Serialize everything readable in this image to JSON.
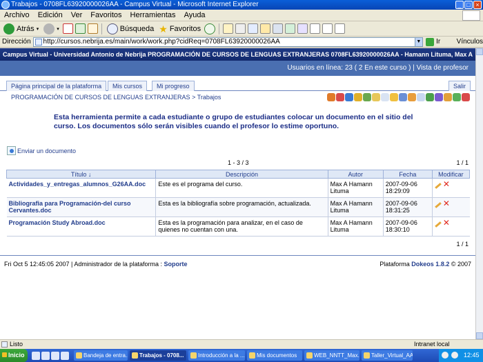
{
  "window": {
    "title": "Trabajos - 0708FL63920000026AA - Campus Virtual - Microsoft Internet Explorer"
  },
  "menu": [
    "Archivo",
    "Edición",
    "Ver",
    "Favoritos",
    "Herramientas",
    "Ayuda"
  ],
  "toolbar": {
    "back_label": "Atrás",
    "search_label": "Búsqueda",
    "favorites_label": "Favoritos"
  },
  "address": {
    "label": "Dirección",
    "url": "http://cursos.nebrija.es/main/work/work.php?cidReq=0708FL63920000026AA",
    "go_label": "Ir",
    "links_label": "Vínculos"
  },
  "site": {
    "header_left": "Campus Virtual - Universidad Antonio de Nebrija",
    "header_right": "PROGRAMACIÓN DE CURSOS DE LENGUAS EXTRANJERAS 0708FL63920000026AA - Hamann Lituma, Max A",
    "online_prefix": "Usuarios en línea:",
    "online_count": "23",
    "online_course": "( 2 En este curso )",
    "teacher_view": "| Vista de profesor"
  },
  "tabs": [
    "Página principal de la plataforma",
    "Mis cursos",
    "Mi progreso"
  ],
  "logout_label": "Salir",
  "breadcrumb": {
    "course": "PROGRAMACIÓN DE CURSOS DE LENGUAS EXTRANJERAS",
    "separator": ">",
    "current": "Trabajos"
  },
  "intro_text": "Esta herramienta permite a cada estudiante o grupo de estudiantes colocar un documento en el sitio del curso. Los documentos sólo serán visibles cuando el profesor lo estime oportuno.",
  "send_label": "Enviar un documento",
  "pager": {
    "range": "1 - 3 / 3",
    "page_top": "1 / 1",
    "page_bottom": "1 / 1"
  },
  "table": {
    "headers": [
      "Título",
      "Descripción",
      "Autor",
      "Fecha",
      "Modificar"
    ],
    "sort_indicator": "↓",
    "rows": [
      {
        "title": "Actividades_y_entregas_alumnos_G26AA.doc",
        "description": "Este es el programa del curso.",
        "author": "Max A Hamann Lituma",
        "date": "2007-09-06 18:29:09"
      },
      {
        "title": "Bibliografia para Programación-del curso Cervantes.doc",
        "description": "Esta es la bibliografía sobre programación, actualizada.",
        "author": "Max A Hamann Lituma",
        "date": "2007-09-06 18:31:25"
      },
      {
        "title": "Programación Study Abroad.doc",
        "description": "Esta es la programación para analizar, en el caso de quienes no cuentan con una.",
        "author": "Max A Hamann Lituma",
        "date": "2007-09-06 18:30:10"
      }
    ]
  },
  "footer": {
    "left_text": "Fri Oct 5 12:45:05 2007 | Administrador de la plataforma :",
    "support_label": "Soporte",
    "platform_prefix": "Plataforma",
    "platform_name": "Dokeos 1.8.2",
    "copyright": "© 2007"
  },
  "status": {
    "left": "Listo",
    "zone": "Intranet local"
  },
  "taskbar": {
    "start_label": "Inicio",
    "tasks": [
      "Bandeja de entra...",
      "Trabajos - 0708...",
      "Introducción a la ...",
      "Mis documentos",
      "WEB_NNTT_Max...",
      "Taller_Virtual_AA..."
    ],
    "active_index": 1,
    "clock": "12:45"
  },
  "colors": {
    "header_bg": "#1f3b86",
    "subheader_bg": "#4a6fb1",
    "link": "#223d8c",
    "intro_text": "#1b2d86",
    "delete_icon": "#e0291e"
  }
}
